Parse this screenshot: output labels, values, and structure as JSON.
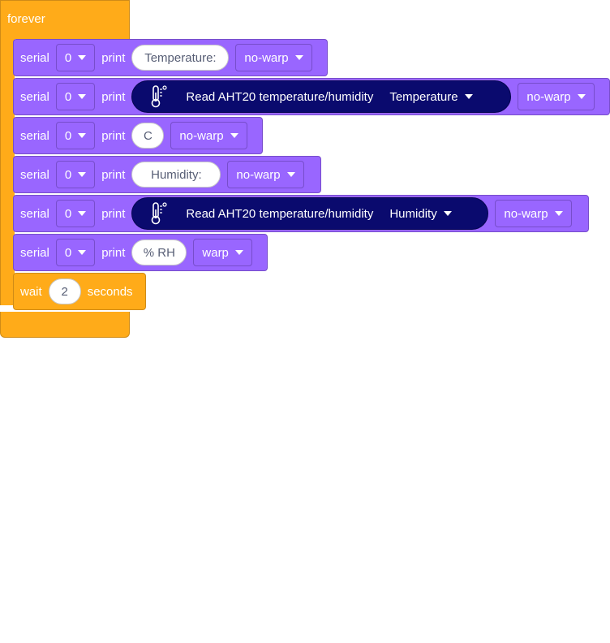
{
  "forever": {
    "label": "forever"
  },
  "rows": [
    {
      "kw": "serial",
      "port": "0",
      "print": "print",
      "text": "Temperature:",
      "warp": "no-warp"
    },
    {
      "kw": "serial",
      "port": "0",
      "print": "print",
      "reporter": {
        "label": "Read AHT20 temperature/humidity",
        "option": "Temperature"
      },
      "warp": "no-warp"
    },
    {
      "kw": "serial",
      "port": "0",
      "print": "print",
      "text": "C",
      "warp": "no-warp"
    },
    {
      "kw": "serial",
      "port": "0",
      "print": "print",
      "text": "Humidity:",
      "warp": "no-warp"
    },
    {
      "kw": "serial",
      "port": "0",
      "print": "print",
      "reporter": {
        "label": "Read AHT20 temperature/humidity",
        "option": "Humidity"
      },
      "warp": "no-warp"
    },
    {
      "kw": "serial",
      "port": "0",
      "print": "print",
      "text": "% RH",
      "warp": "warp"
    }
  ],
  "wait": {
    "label": "wait",
    "value": "2",
    "unit": "seconds"
  },
  "icons": {
    "thermometer": "thermometer-icon",
    "loop": "loop-arrow-icon"
  },
  "colors": {
    "control": "#FFAB19",
    "serial": "#9966FF",
    "reporter": "#0A0A6E"
  }
}
